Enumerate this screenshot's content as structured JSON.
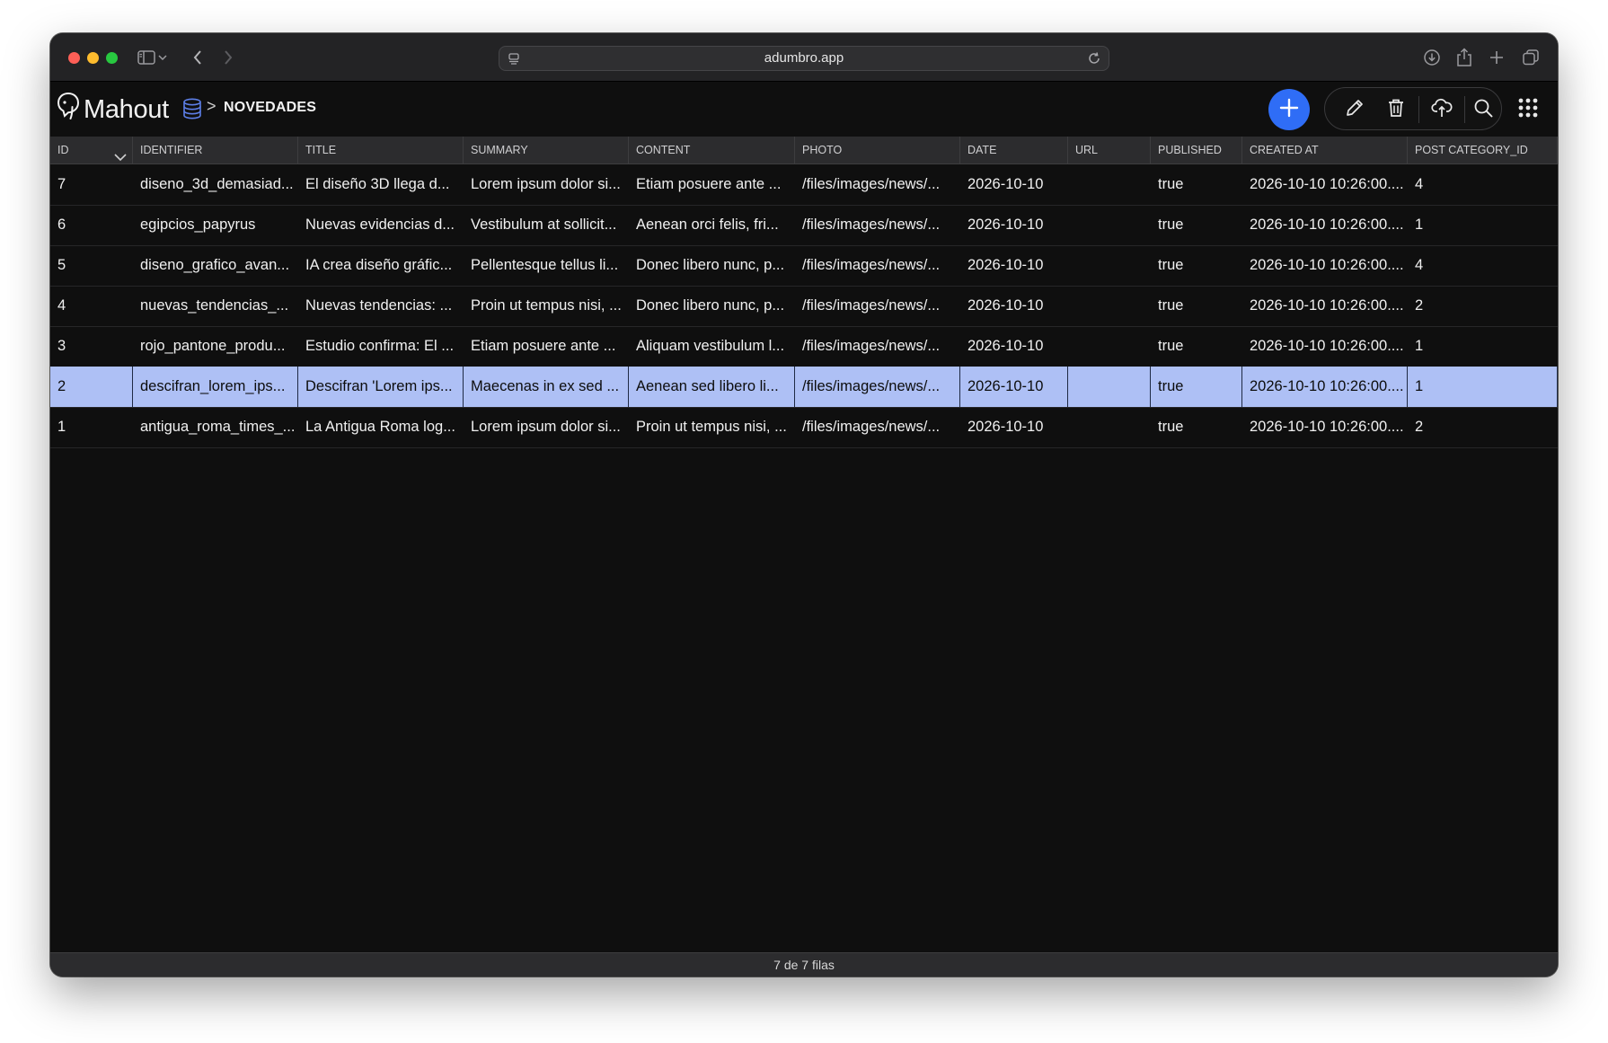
{
  "browser": {
    "url": "adumbro.app"
  },
  "app": {
    "logo_text": "Mahout",
    "breadcrumb_separator": ">",
    "breadcrumb_current": "NOVEDADES",
    "accent_color": "#2f6df6",
    "selection_color": "#aec0f5"
  },
  "toolbar": {
    "icons": [
      "plus-icon",
      "pencil-icon",
      "trash-icon",
      "cloud-upload-icon",
      "search-icon",
      "apps-grid-icon"
    ]
  },
  "table": {
    "columns": [
      "ID",
      "IDENTIFIER",
      "TITLE",
      "SUMMARY",
      "CONTENT",
      "PHOTO",
      "DATE",
      "URL",
      "PUBLISHED",
      "CREATED AT",
      "POST CATEGORY_ID"
    ],
    "selected_row_index": 5,
    "rows": [
      [
        "7",
        "diseno_3d_demasiad...",
        "El diseño 3D llega d...",
        "Lorem ipsum dolor si...",
        "Etiam posuere ante ...",
        "/files/images/news/...",
        "2026-10-10",
        "",
        "true",
        "2026-10-10 10:26:00....",
        "4"
      ],
      [
        "6",
        "egipcios_papyrus",
        "Nuevas evidencias d...",
        "Vestibulum at sollicit...",
        "Aenean orci felis, fri...",
        "/files/images/news/...",
        "2026-10-10",
        "",
        "true",
        "2026-10-10 10:26:00....",
        "1"
      ],
      [
        "5",
        "diseno_grafico_avan...",
        "IA crea diseño gráfic...",
        "Pellentesque tellus li...",
        "Donec libero nunc, p...",
        "/files/images/news/...",
        "2026-10-10",
        "",
        "true",
        "2026-10-10 10:26:00....",
        "4"
      ],
      [
        "4",
        "nuevas_tendencias_...",
        "Nuevas tendencias: ...",
        "Proin ut tempus nisi, ...",
        "Donec libero nunc, p...",
        "/files/images/news/...",
        "2026-10-10",
        "",
        "true",
        "2026-10-10 10:26:00....",
        "2"
      ],
      [
        "3",
        "rojo_pantone_produ...",
        "Estudio confirma: El ...",
        "Etiam posuere ante ...",
        "Aliquam vestibulum l...",
        "/files/images/news/...",
        "2026-10-10",
        "",
        "true",
        "2026-10-10 10:26:00....",
        "1"
      ],
      [
        "2",
        "descifran_lorem_ips...",
        "Descifran 'Lorem ips...",
        "Maecenas in ex sed ...",
        "Aenean sed libero li...",
        "/files/images/news/...",
        "2026-10-10",
        "",
        "true",
        "2026-10-10 10:26:00....",
        "1"
      ],
      [
        "1",
        "antigua_roma_times_...",
        "La Antigua Roma log...",
        "Lorem ipsum dolor si...",
        "Proin ut tempus nisi, ...",
        "/files/images/news/...",
        "2026-10-10",
        "",
        "true",
        "2026-10-10 10:26:00....",
        "2"
      ]
    ]
  },
  "status": {
    "row_count_text": "7 de 7 filas"
  }
}
